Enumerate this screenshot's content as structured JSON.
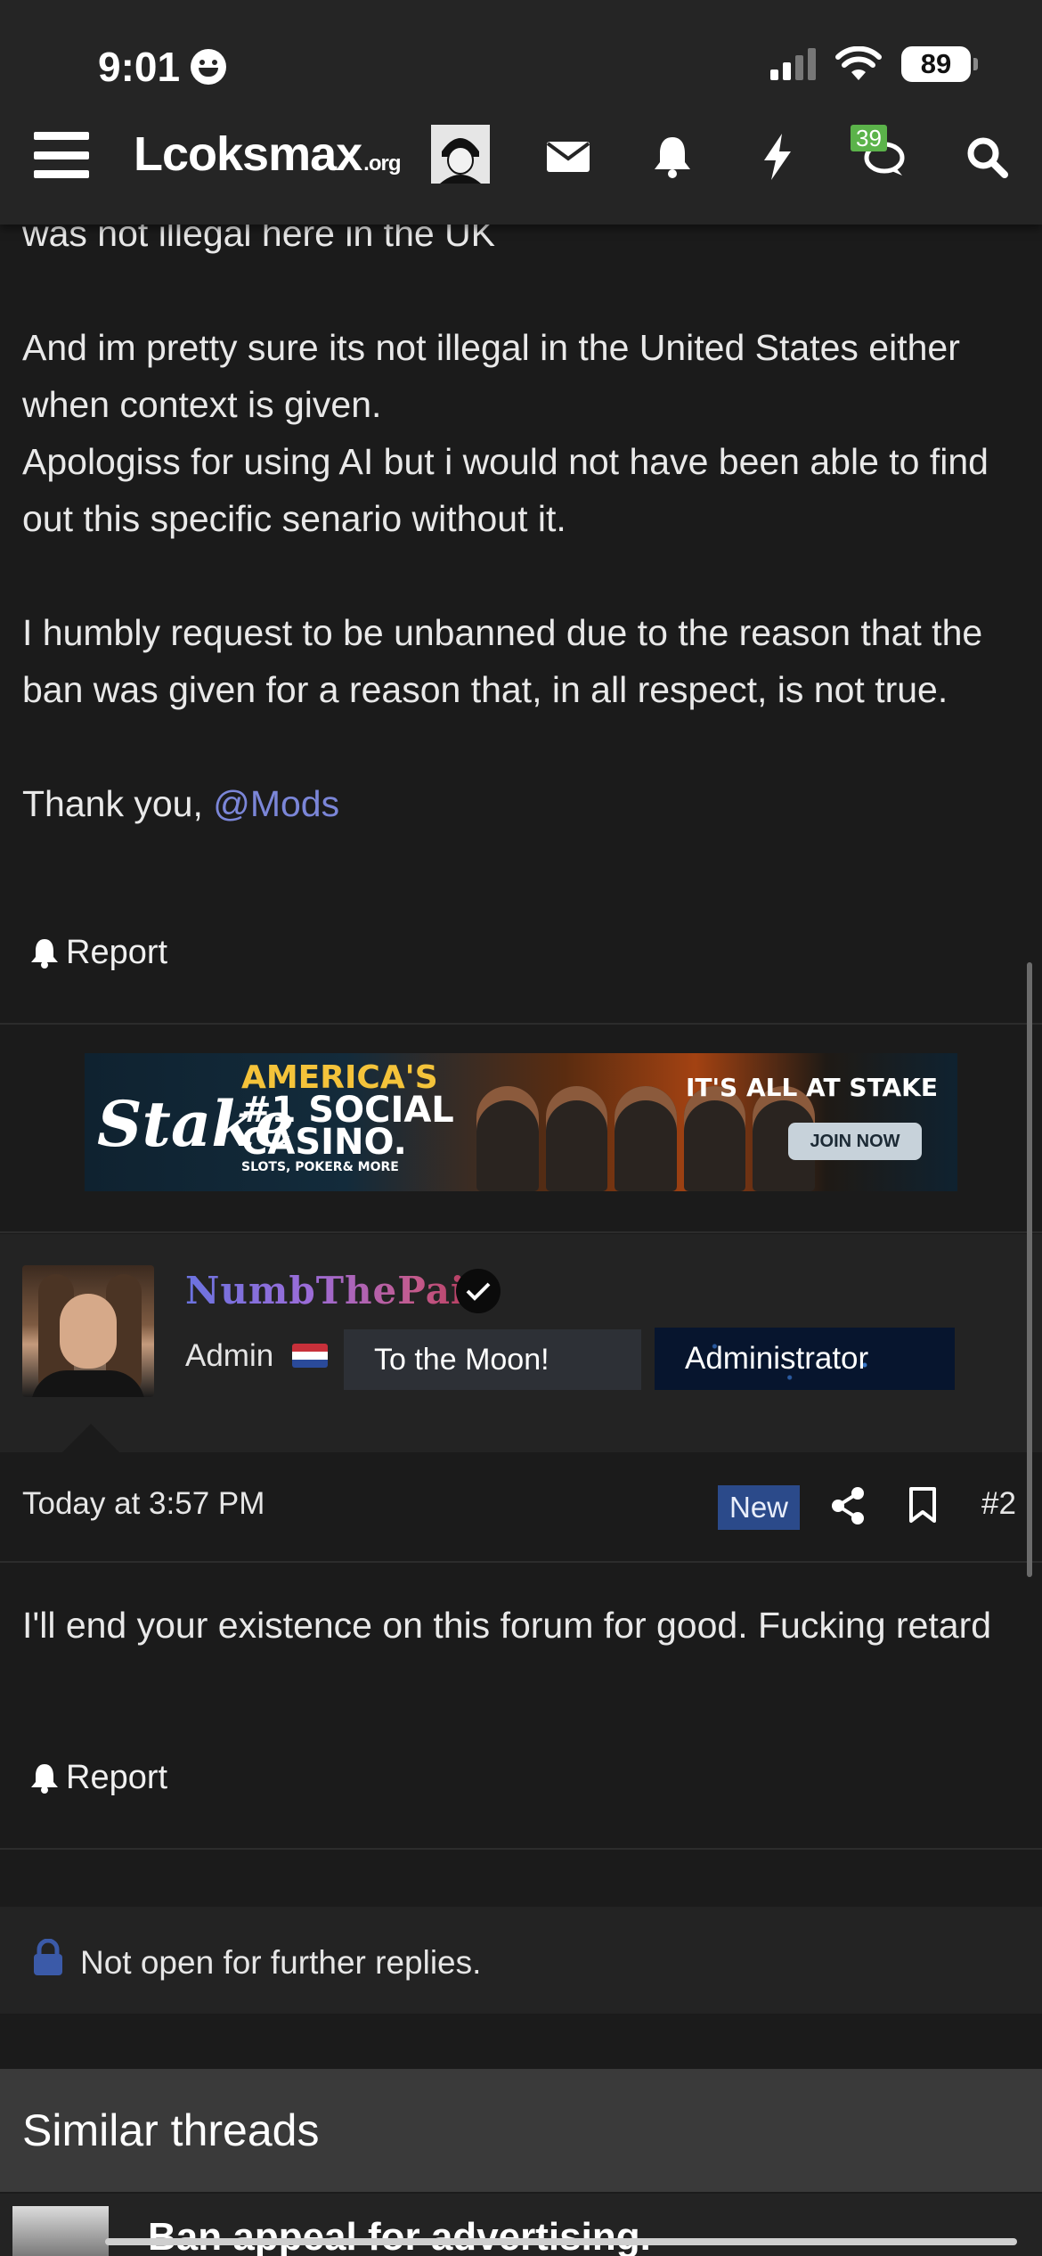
{
  "status_bar": {
    "time": "9:01",
    "battery": "89"
  },
  "header": {
    "logo_main": "Lcoksmax",
    "logo_suffix": ".org",
    "alerts_count": "39"
  },
  "post": {
    "partial_top_line": "was not illegal here in the UK",
    "lines": [
      "And im pretty sure its not illegal in the United States either when context is given.",
      "Apologiss for using AI but i would not have been able to find out this specific senario without it."
    ],
    "request": "I humbly request to be unbanned due to the reason that the ban was given for a reason that, in all respect, is not true.",
    "thanks_prefix": "Thank you, ",
    "mention": "@Mods",
    "report_label": "Report"
  },
  "ad": {
    "brand": "Stake",
    "headline_1": "AMERICA'S",
    "headline_2": "#1 SOCIAL",
    "headline_3": "CASINO.",
    "subline": "SLOTS, POKER& MORE",
    "tagline": "IT'S ALL AT STAKE",
    "button": "JOIN NOW"
  },
  "reply": {
    "username": "NumbThePain",
    "role": "Admin",
    "tag_1": "To the Moon!",
    "tag_2": "Administrator",
    "timestamp": "Today at 3:57 PM",
    "new_badge": "New",
    "post_number": "#2",
    "text": "I'll end your existence on this forum for good. Fucking retard",
    "report_label": "Report"
  },
  "thread_status": {
    "text": "Not open for further replies."
  },
  "similar": {
    "title": "Similar threads",
    "first_thread": "Ban appeal for advertising."
  },
  "colors": {
    "mention": "#7b86d8",
    "new_badge": "#2b4a8a",
    "lock": "#3b5aa8"
  }
}
